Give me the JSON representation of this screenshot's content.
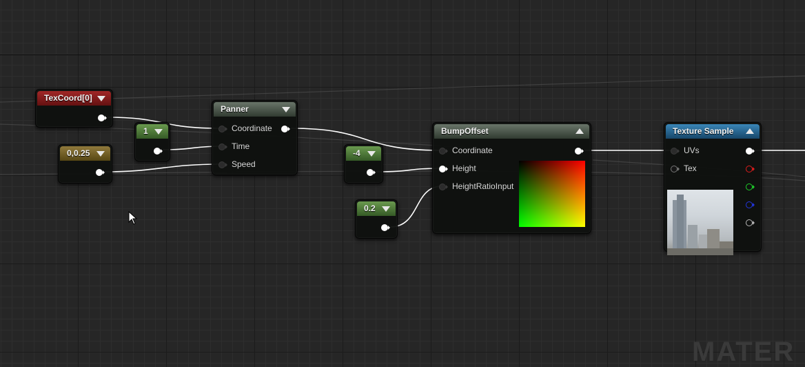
{
  "editor": {
    "watermark": "MATER"
  },
  "nodes": {
    "texcoord": {
      "title": "TexCoord[0]"
    },
    "const1": {
      "title": "1"
    },
    "const2": {
      "title": "0,0.25"
    },
    "panner": {
      "title": "Panner",
      "inputs": [
        "Coordinate",
        "Time",
        "Speed"
      ]
    },
    "const_neg4": {
      "title": "-4"
    },
    "const_02": {
      "title": "0.2"
    },
    "bumpoffset": {
      "title": "BumpOffset",
      "inputs": [
        "Coordinate",
        "Height",
        "HeightRatioInput"
      ]
    },
    "texture_sample": {
      "title": "Texture Sample",
      "inputs": [
        "UVs",
        "Tex"
      ]
    }
  },
  "colors": {
    "background": "#262626",
    "wire": "#ffffff",
    "header_red": "#a12727",
    "header_green": "#6a9a4f",
    "header_olive": "#917a3c",
    "header_gray": "#697569",
    "header_blue": "#3a86b7",
    "pin_red": "#e01d1d",
    "pin_green": "#1fcf2b",
    "pin_blue": "#2336e0"
  },
  "icons": [
    "collapse-arrow-icon",
    "pin-icon",
    "mouse-cursor-icon"
  ]
}
